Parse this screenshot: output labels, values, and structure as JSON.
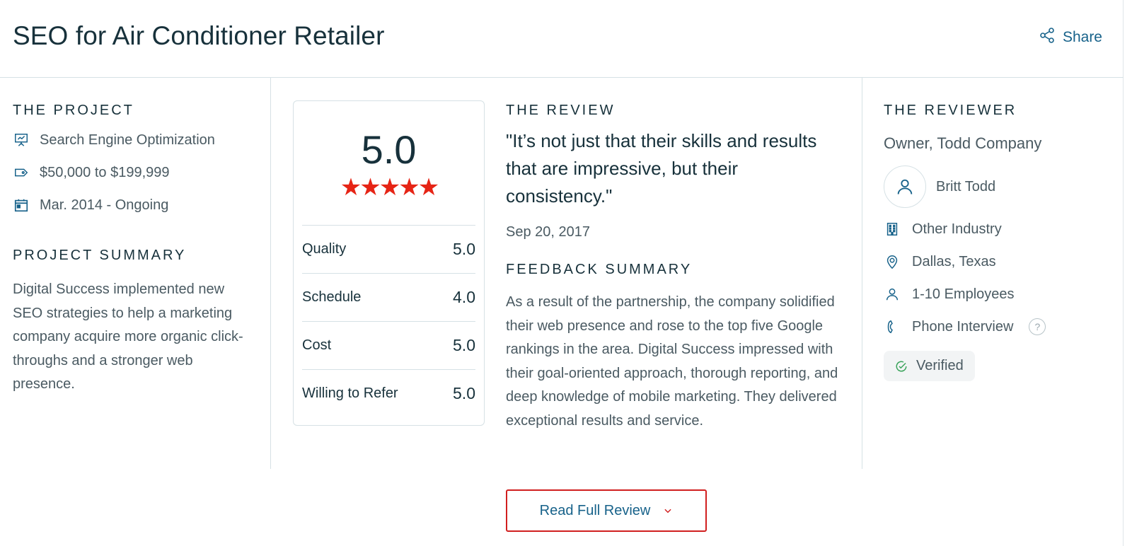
{
  "header": {
    "title": "SEO for Air Conditioner Retailer",
    "share_label": "Share"
  },
  "project": {
    "heading": "THE PROJECT",
    "service": "Search Engine Optimization",
    "budget": "$50,000 to $199,999",
    "dates": "Mar. 2014 - Ongoing",
    "summary_heading": "PROJECT SUMMARY",
    "summary": "Digital Success implemented new SEO strategies to help a marketing company acquire more organic click-throughs and a stronger web presence."
  },
  "rating": {
    "overall": "5.0",
    "stars": "★★★★★",
    "star_count": 5,
    "rows": [
      {
        "label": "Quality",
        "value": "5.0"
      },
      {
        "label": "Schedule",
        "value": "4.0"
      },
      {
        "label": "Cost",
        "value": "5.0"
      },
      {
        "label": "Willing to Refer",
        "value": "5.0"
      }
    ]
  },
  "review": {
    "heading": "THE REVIEW",
    "quote": "\"It’s not just that their skills and results that are impressive, but their consistency.\"",
    "date": "Sep 20, 2017",
    "feedback_heading": "FEEDBACK SUMMARY",
    "feedback": "As a result of the partnership, the company solidified their web presence and rose to the top five Google rankings in the area. Digital Success impressed with their goal-oriented approach, thorough reporting, and deep knowledge of mobile marketing. They delivered exceptional results and service."
  },
  "reviewer": {
    "heading": "THE REVIEWER",
    "title": "Owner, Todd Company",
    "name": "Britt Todd",
    "industry": "Other Industry",
    "location": "Dallas, Texas",
    "size": "1-10 Employees",
    "interview": "Phone Interview",
    "help": "?",
    "verified": "Verified"
  },
  "actions": {
    "read_full_review": "Read Full Review"
  },
  "colors": {
    "accent": "#17628a",
    "star": "#e62415",
    "button_border": "#d11f1f",
    "verified_check": "#3aa35b"
  }
}
